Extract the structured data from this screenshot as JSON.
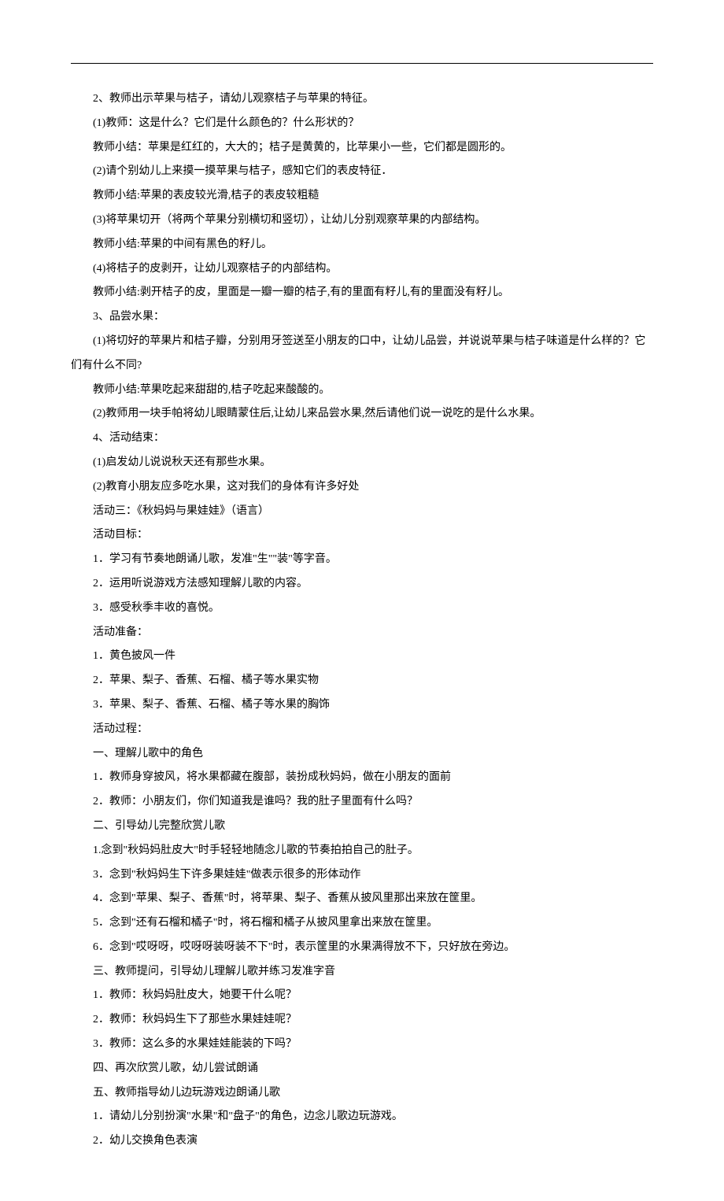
{
  "lines": [
    "2、教师出示苹果与桔子，请幼儿观察桔子与苹果的特征。",
    "(1)教师：这是什么？它们是什么颜色的？什么形状的？",
    "教师小结：苹果是红红的，大大的；桔子是黄黄的，比苹果小一些，它们都是圆形的。",
    "(2)请个别幼儿上来摸一摸苹果与桔子，感知它们的表皮特征．",
    "教师小结:苹果的表皮较光滑,桔子的表皮较粗糙",
    "(3)将苹果切开（将两个苹果分别横切和竖切），让幼儿分别观察苹果的内部结构。",
    "教师小结:苹果的中间有黑色的籽儿。",
    "(4)将桔子的皮剥开，让幼儿观察桔子的内部结构。",
    "教师小结:剥开桔子的皮，里面是一瓣一瓣的桔子,有的里面有籽儿,有的里面没有籽儿。",
    "3、品尝水果：",
    "(1)将切好的苹果片和桔子瓣，分别用牙签送至小朋友的口中，让幼儿品尝，并说说苹果与桔子味道是什么样的？它"
  ],
  "overflow_line": "们有什么不同?",
  "lines2": [
    "教师小结:苹果吃起来甜甜的,桔子吃起来酸酸的。",
    "(2)教师用一块手帕将幼儿眼睛蒙住后,让幼儿来品尝水果,然后请他们说一说吃的是什么水果。",
    "4、活动结束：",
    "(1)启发幼儿说说秋天还有那些水果。",
    "(2)教育小朋友应多吃水果，这对我们的身体有许多好处",
    "活动三：《秋妈妈与果娃娃》（语言）",
    "活动目标：",
    "1．学习有节奏地朗诵儿歌，发准\"生\"\"装\"等字音。",
    "2．运用听说游戏方法感知理解儿歌的内容。",
    "3．感受秋季丰收的喜悦。",
    "活动准备：",
    "1．黄色披风一件",
    "2．苹果、梨子、香蕉、石榴、橘子等水果实物",
    "3．苹果、梨子、香蕉、石榴、橘子等水果的胸饰",
    "活动过程：",
    "一、理解儿歌中的角色",
    "1．教师身穿披风，将水果都藏在腹部，装扮成秋妈妈，做在小朋友的面前",
    "2．教师：小朋友们，你们知道我是谁吗？我的肚子里面有什么吗？",
    "二、引导幼儿完整欣赏儿歌",
    "1.念到\"秋妈妈肚皮大\"时手轻轻地随念儿歌的节奏拍拍自己的肚子。",
    "3．念到\"秋妈妈生下许多果娃娃\"做表示很多的形体动作",
    "4．念到\"苹果、梨子、香蕉\"时，将苹果、梨子、香蕉从披风里那出来放在筐里。",
    "5．念到\"还有石榴和橘子\"时，将石榴和橘子从披风里拿出来放在筐里。",
    "6．念到\"哎呀呀，哎呀呀装呀装不下\"时，表示筐里的水果满得放不下，只好放在旁边。",
    "三、教师提问，引导幼儿理解儿歌并练习发准字音",
    "1．教师：秋妈妈肚皮大，她要干什么呢？",
    "2．教师：秋妈妈生下了那些水果娃娃呢？",
    "3．教师：这么多的水果娃娃能装的下吗？",
    "四、再次欣赏儿歌，幼儿尝试朗诵",
    "五、教师指导幼儿边玩游戏边朗诵儿歌",
    "1．请幼儿分别扮演\"水果\"和\"盘子\"的角色，边念儿歌边玩游戏。",
    "2．幼儿交换角色表演"
  ]
}
